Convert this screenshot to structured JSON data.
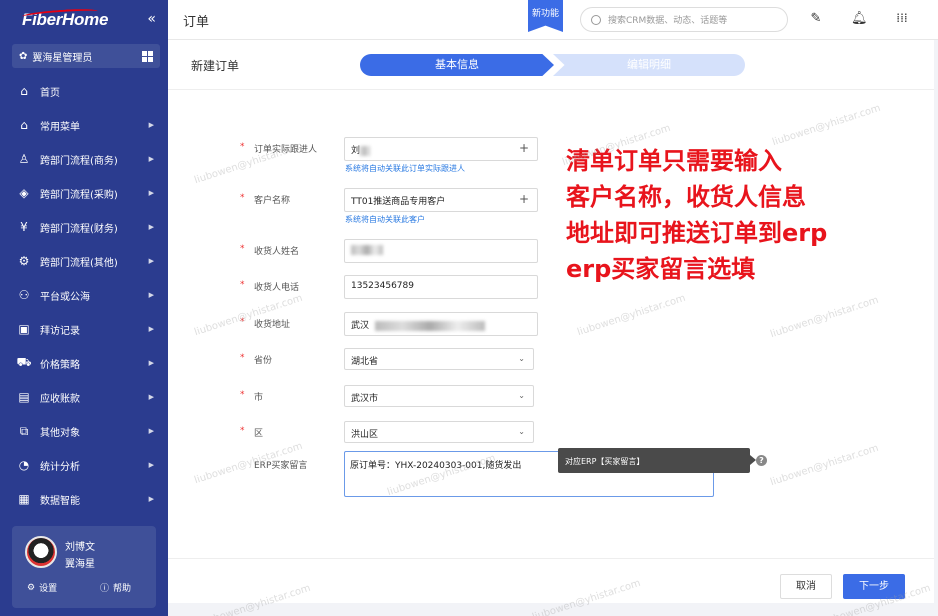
{
  "sidebar": {
    "logo": "FiberHome",
    "collapse_icon": "«",
    "role": "翼海星管理员",
    "items": [
      {
        "label": "首页",
        "icon": "home-icon",
        "glyph": "⌂",
        "has_arrow": false
      },
      {
        "label": "常用菜单",
        "icon": "menu-home-icon",
        "glyph": "⌂",
        "has_arrow": true
      },
      {
        "label": "跨部门流程(商务)",
        "icon": "person-icon",
        "glyph": "♙",
        "has_arrow": true
      },
      {
        "label": "跨部门流程(采购)",
        "icon": "box-icon",
        "glyph": "◈",
        "has_arrow": true
      },
      {
        "label": "跨部门流程(财务)",
        "icon": "currency-icon",
        "glyph": "¥",
        "has_arrow": true
      },
      {
        "label": "跨部门流程(其他)",
        "icon": "gear-icon",
        "glyph": "⚙",
        "has_arrow": true
      },
      {
        "label": "平台或公海",
        "icon": "people-icon",
        "glyph": "⚇",
        "has_arrow": true
      },
      {
        "label": "拜访记录",
        "icon": "calendar-icon",
        "glyph": "▣",
        "has_arrow": true
      },
      {
        "label": "价格策略",
        "icon": "cart-icon",
        "glyph": "⛟",
        "has_arrow": true
      },
      {
        "label": "应收账款",
        "icon": "receivable-icon",
        "glyph": "▤",
        "has_arrow": true
      },
      {
        "label": "其他对象",
        "icon": "object-icon",
        "glyph": "⧉",
        "has_arrow": true
      },
      {
        "label": "统计分析",
        "icon": "pie-chart-icon",
        "glyph": "◔",
        "has_arrow": true
      },
      {
        "label": "数据智能",
        "icon": "data-icon",
        "glyph": "▦",
        "has_arrow": true
      }
    ],
    "user": {
      "name": "刘博文",
      "org": "翼海星",
      "settings": "设置",
      "help": "帮助"
    }
  },
  "topbar": {
    "title": "订单",
    "new_feature": "新功能",
    "search_placeholder": "搜索CRM数据、动态、话题等"
  },
  "page": {
    "subtitle": "新建订单",
    "steps": [
      "基本信息",
      "编辑明细"
    ]
  },
  "form": {
    "fields": [
      {
        "label": "订单实际跟进人",
        "value": "刘",
        "hint": "系统将自动关联此订单实际跟进人",
        "type": "lookup"
      },
      {
        "label": "客户名称",
        "value": "TT01推送商品专用客户",
        "hint": "系统将自动关联此客户",
        "type": "lookup"
      },
      {
        "label": "收货人姓名",
        "value": "",
        "type": "text"
      },
      {
        "label": "收货人电话",
        "value": "13523456789",
        "type": "text"
      },
      {
        "label": "收货地址",
        "value": "武汉",
        "type": "text"
      },
      {
        "label": "省份",
        "value": "湖北省",
        "type": "select"
      },
      {
        "label": "市",
        "value": "武汉市",
        "type": "select"
      },
      {
        "label": "区",
        "value": "洪山区",
        "type": "select"
      }
    ],
    "message_label": "ERP买家留言",
    "message_value": "原订单号：YHX-20240303-001,随货发出",
    "tooltip": "对应ERP【买家留言】",
    "help_glyph": "?"
  },
  "annotation": [
    "清单订单只需要输入",
    "客户名称，收货人信息",
    "地址即可推送订单到erp",
    "erp买家留言选填"
  ],
  "footer": {
    "cancel": "取消",
    "next": "下一步"
  },
  "watermark": "liubowen@yhistar.com",
  "colors": {
    "sidebar": "#2b3c8f",
    "primary": "#3b6ce6",
    "annotation": "#e8141c"
  }
}
